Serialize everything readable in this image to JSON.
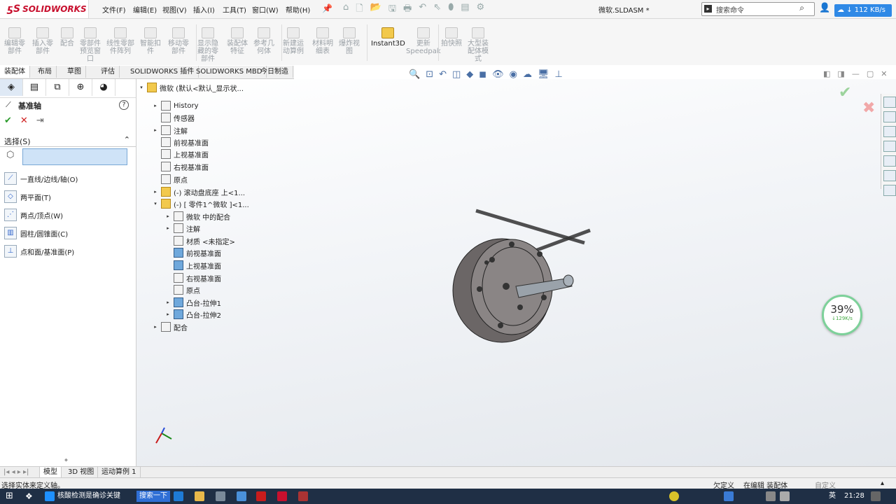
{
  "app": {
    "brand": "SOLIDWORKS",
    "menu": [
      "文件(F)",
      "编辑(E)",
      "视图(V)",
      "插入(I)",
      "工具(T)",
      "窗口(W)",
      "帮助(H)"
    ],
    "document_title": "微软.SLDASM *",
    "search_placeholder": "搜索命令",
    "net_speed": "↓ 112 KB/s"
  },
  "commands": [
    {
      "label": "编辑零\n部件"
    },
    {
      "label": "插入零\n部件"
    },
    {
      "label": "配合"
    },
    {
      "label": "零部件\n预览窗\n口"
    },
    {
      "label": "线性零部\n件阵列"
    },
    {
      "label": "智能扣\n件"
    },
    {
      "label": "移动零\n部件"
    },
    {
      "label": "显示隐\n藏的零\n部件"
    },
    {
      "label": "装配体\n特征"
    },
    {
      "label": "参考几\n何体"
    },
    {
      "label": "新建运\n动算例"
    },
    {
      "label": "材料明\n细表"
    },
    {
      "label": "爆炸视\n图"
    },
    {
      "label": "Instant3D"
    },
    {
      "label": "更新\nSpeedpak"
    },
    {
      "label": "拍快照"
    },
    {
      "label": "大型装\n配体模\n式"
    }
  ],
  "tabs": [
    "装配体",
    "布局",
    "草图",
    "评估",
    "SOLIDWORKS 插件",
    "SOLIDWORKS MBD",
    "今日制造"
  ],
  "property_manager": {
    "title": "基准轴",
    "help": "?",
    "ok": "✔",
    "cancel": "✕",
    "pin": "⇥",
    "section_title": "选择(S)",
    "collapse": "⌃",
    "options": [
      "一直线/边线/轴(O)",
      "两平面(T)",
      "两点/顶点(W)",
      "圆柱/圆锥面(C)",
      "点和面/基准面(P)"
    ]
  },
  "tree": {
    "root": "微软 (默认<默认_显示状...",
    "items": [
      {
        "label": "History"
      },
      {
        "label": "传感器"
      },
      {
        "label": "注解"
      },
      {
        "label": "前视基准面"
      },
      {
        "label": "上视基准面"
      },
      {
        "label": "右视基准面"
      },
      {
        "label": "原点"
      },
      {
        "label": "(-) 滚动盘底座 上<1..."
      },
      {
        "label": "(-) [ 零件1^微软 ]<1..."
      },
      {
        "label": "微软 中的配合"
      },
      {
        "label": "注解"
      },
      {
        "label": "材质 <未指定>"
      },
      {
        "label": "前视基准面"
      },
      {
        "label": "上视基准面"
      },
      {
        "label": "右视基准面"
      },
      {
        "label": "原点"
      },
      {
        "label": "凸台-拉伸1"
      },
      {
        "label": "凸台-拉伸2"
      },
      {
        "label": "配合"
      }
    ]
  },
  "gauge": {
    "percent": "39%",
    "speed": "↓129K/s"
  },
  "bottom_tabs": [
    "模型",
    "3D 视图",
    "运动算例 1"
  ],
  "status": {
    "left": "选择实体来定义轴。",
    "s1": "欠定义",
    "s2": "在编辑 装配体",
    "s3": "自定义"
  },
  "taskbar": {
    "search_text": "核酸检测是确诊关键",
    "search_button": "搜索一下",
    "ime": "英",
    "time": "21:28"
  },
  "colors": {
    "brand_red": "#c8102e",
    "accent_blue": "#2f89e6",
    "taskbar": "#1f2f45"
  }
}
